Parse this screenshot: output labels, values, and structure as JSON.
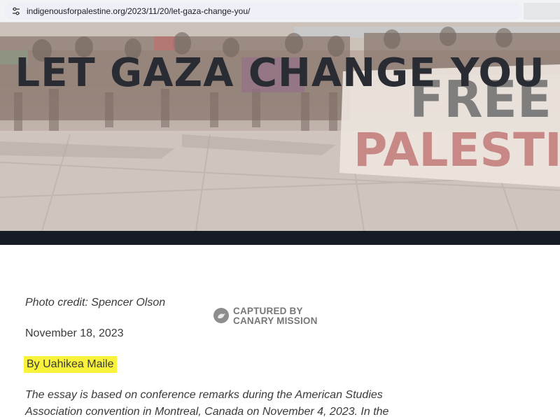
{
  "browser": {
    "url": "indigenousforpalestine.org/2023/11/20/let-gaza-change-you/",
    "site_icon": "tune-icon"
  },
  "hero": {
    "title": "LET GAZA CHANGE YOU",
    "banner_text_line1": "FREE",
    "banner_text_line2": "PALESTINE"
  },
  "article": {
    "photo_credit": "Photo credit: Spencer Olson",
    "date": "November 18, 2023",
    "byline": "By Uahikea Maile",
    "intro": "The essay is based on conference remarks during the American Studies Association convention in Montreal, Canada on November 4, 2023. In the"
  },
  "watermark": {
    "line1": "CAPTURED BY",
    "line2": "CANARY MISSION",
    "icon": "canary-bird-icon"
  },
  "colors": {
    "highlight": "#f8f33a",
    "title": "#2a2c33",
    "dark_band": "#171b26",
    "text": "#3a3a3a"
  }
}
